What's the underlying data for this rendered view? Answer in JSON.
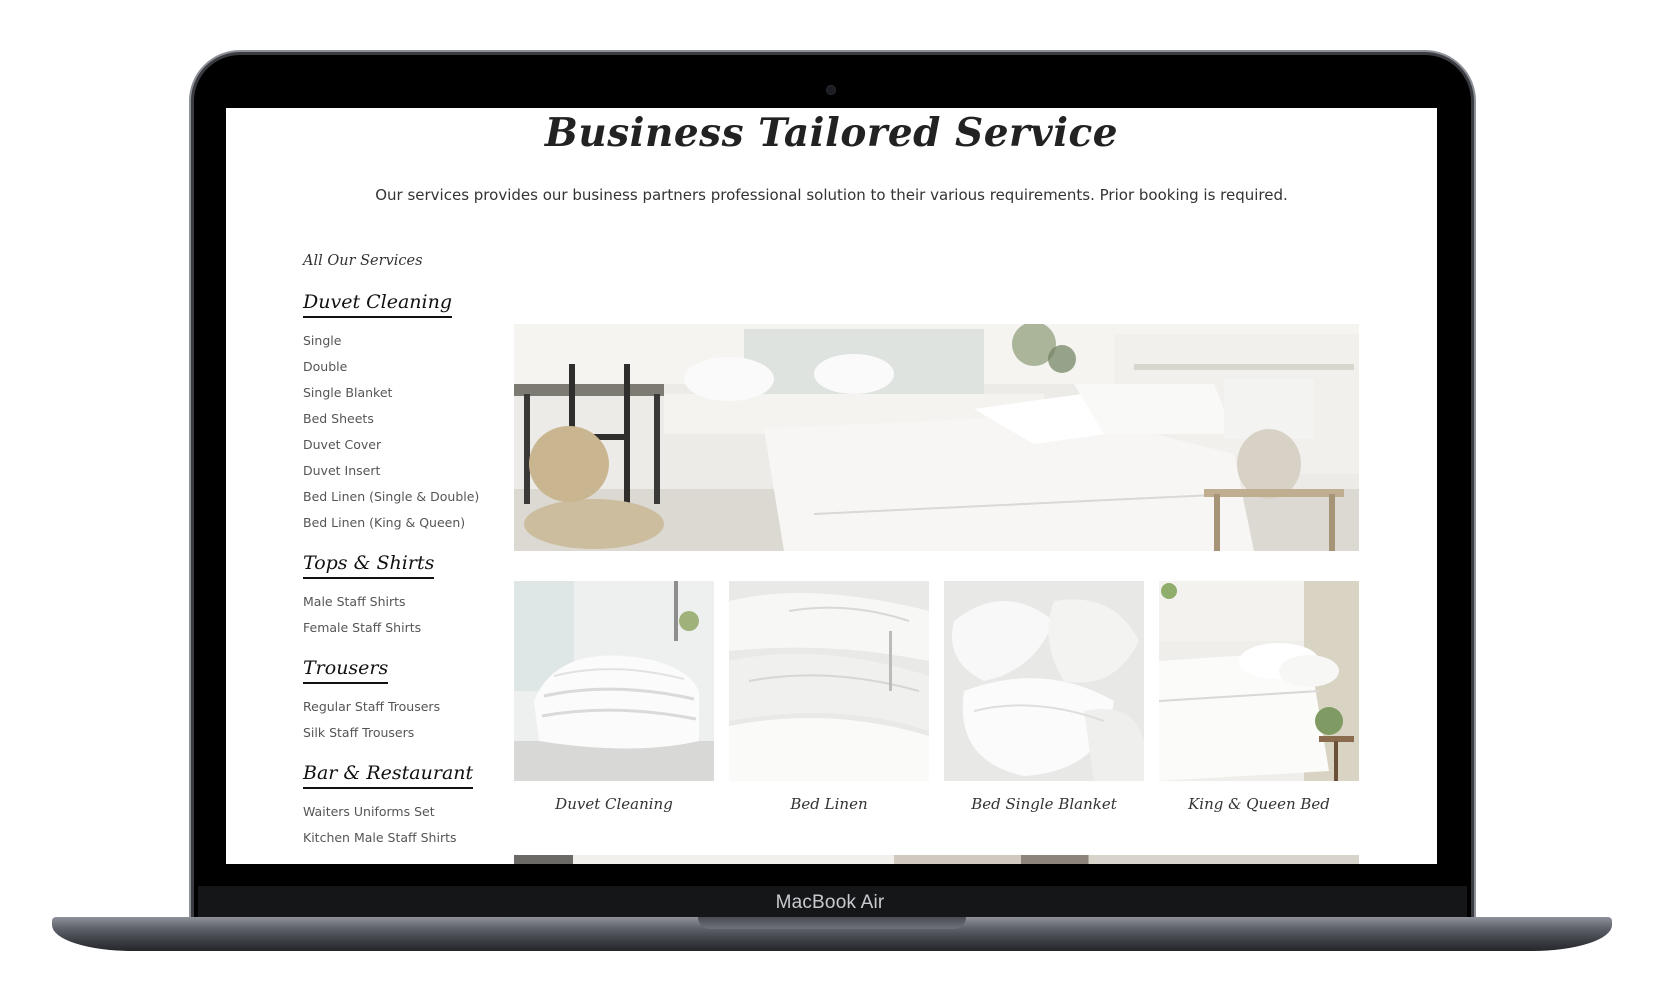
{
  "device": {
    "label": "MacBook Air"
  },
  "page": {
    "title": "Business Tailored Service",
    "subtitle": "Our services provides our business partners professional solution to their various requirements. Prior booking is required."
  },
  "sidebar": {
    "all_services_label": "All Our Services",
    "categories": [
      {
        "title": "Duvet Cleaning",
        "items": [
          "Single",
          "Double",
          "Single Blanket",
          "Bed Sheets",
          "Duvet Cover",
          "Duvet Insert",
          "Bed Linen (Single & Double)",
          "Bed Linen (King & Queen)"
        ]
      },
      {
        "title": "Tops & Shirts",
        "items": [
          "Male Staff Shirts",
          "Female Staff Shirts"
        ]
      },
      {
        "title": "Trousers",
        "items": [
          "Regular Staff Trousers",
          "Silk Staff Trousers"
        ]
      },
      {
        "title": "Bar & Restaurant",
        "items": [
          "Waiters Uniforms Set",
          "Kitchen Male Staff Shirts"
        ]
      }
    ]
  },
  "cards": [
    {
      "label": "Duvet Cleaning",
      "image": "folded-duvet-photo"
    },
    {
      "label": "Bed Linen",
      "image": "bed-linen-photo"
    },
    {
      "label": "Bed Single Blanket",
      "image": "pillows-photo"
    },
    {
      "label": "King & Queen Bed",
      "image": "king-bed-photo"
    }
  ],
  "hero": {
    "image": "bedroom-photo"
  }
}
